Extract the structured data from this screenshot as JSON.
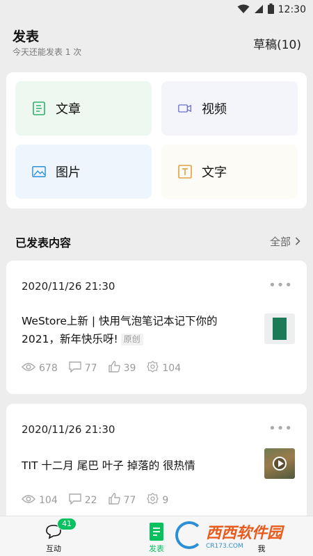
{
  "status_bar": {
    "time": "12:30"
  },
  "header": {
    "title": "发表",
    "subtitle": "今天还能发表 1 次",
    "drafts_label": "草稿(10)"
  },
  "compose": {
    "tiles": [
      {
        "label": "文章",
        "icon": "article-icon"
      },
      {
        "label": "视频",
        "icon": "video-icon"
      },
      {
        "label": "图片",
        "icon": "image-icon"
      },
      {
        "label": "文字",
        "icon": "text-icon"
      }
    ]
  },
  "published": {
    "section_title": "已发表内容",
    "all_label": "全部"
  },
  "posts": [
    {
      "date": "2020/11/26 21:30",
      "title": "WeStore上新 | 快用气泡笔记本记下你的 2021，新年快乐呀!",
      "badge": "原创",
      "views": "678",
      "comments": "77",
      "likes": "39",
      "shares": "104"
    },
    {
      "date": "2020/11/26 21:30",
      "title": "TIT 十二月 尾巴 叶子 掉落的 很热情",
      "views": "104",
      "comments": "22",
      "likes": "77",
      "shares": "9"
    }
  ],
  "tabbar": {
    "interact_label": "互动",
    "interact_badge": "41",
    "publish_label": "发表",
    "me_label": "我"
  },
  "watermark": {
    "text": "西西软件园",
    "sub": "CR173.COM"
  },
  "colors": {
    "accent": "#07c160",
    "background": "#ededed"
  }
}
